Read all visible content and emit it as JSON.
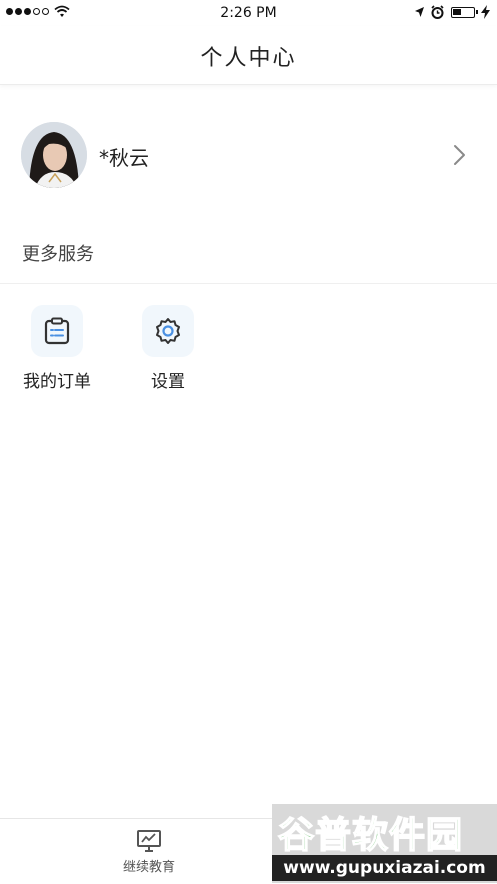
{
  "status_bar": {
    "time": "2:26 PM",
    "signal_icon": "cellular-signal-icon",
    "wifi_icon": "wifi-icon",
    "location_icon": "location-arrow-icon",
    "alarm_icon": "alarm-clock-icon",
    "battery_icon": "battery-icon",
    "charging_icon": "charging-bolt-icon"
  },
  "nav": {
    "title": "个人中心"
  },
  "profile": {
    "username": "*秋云",
    "avatar_icon": "user-avatar",
    "chevron_icon": "chevron-right-icon"
  },
  "more_services": {
    "title": "更多服务",
    "items": [
      {
        "label": "我的订单",
        "icon": "clipboard-list-icon"
      },
      {
        "label": "设置",
        "icon": "gear-icon"
      }
    ]
  },
  "tabbar": {
    "items": [
      {
        "label": "继续教育",
        "icon": "presentation-chart-icon"
      }
    ]
  },
  "watermark": {
    "text": "谷普软件园",
    "url": "www.gupuxiazai.com"
  },
  "colors": {
    "icon_tile_bg": "#f1f7fc",
    "icon_accent": "#4a90e2",
    "watermark_green": "#4caf50"
  }
}
